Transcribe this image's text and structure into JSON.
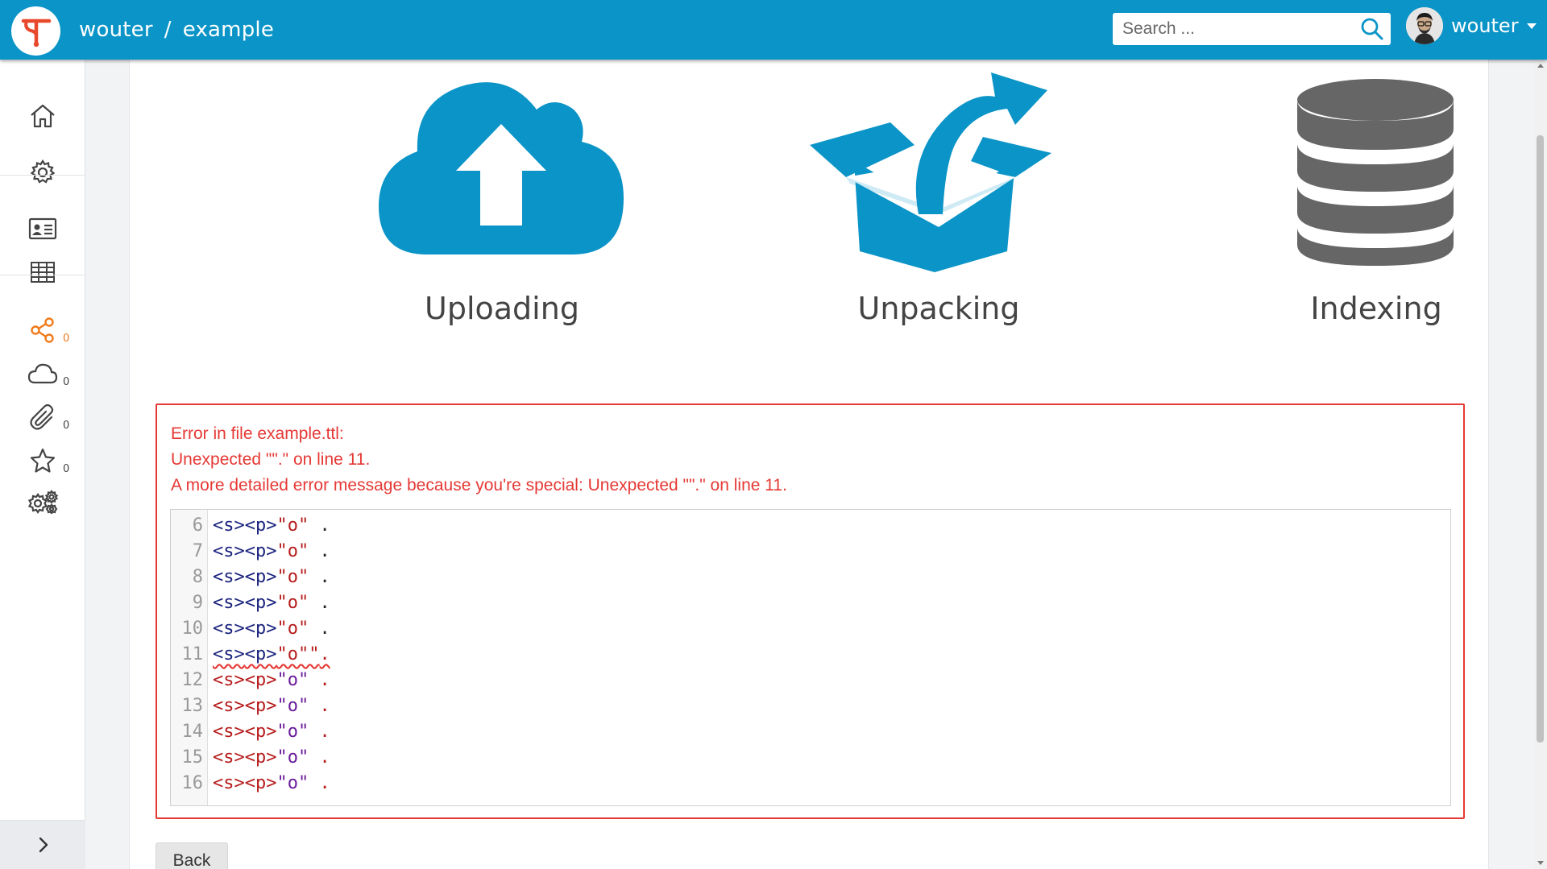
{
  "header": {
    "logo_letter": "T",
    "breadcrumb": {
      "user": "wouter",
      "separator": "/",
      "dataset": "example"
    },
    "search": {
      "placeholder": "Search ..."
    },
    "account": {
      "name": "wouter"
    }
  },
  "sidebar": {
    "items": [
      {
        "icon": "home-icon"
      },
      {
        "icon": "gear-icon"
      },
      {
        "icon": "id-card-icon"
      },
      {
        "icon": "table-icon"
      },
      {
        "icon": "share-graph-icon",
        "count": "0"
      },
      {
        "icon": "cloud-icon",
        "count": "0"
      },
      {
        "icon": "paperclip-icon",
        "count": "0"
      },
      {
        "icon": "star-icon",
        "count": "0"
      },
      {
        "icon": "gears-icon"
      },
      {
        "icon": "git-branch-icon"
      }
    ],
    "expand_icon": "chevron-right-icon"
  },
  "steps": [
    {
      "label": "Uploading",
      "icon": "cloud-upload-icon",
      "color": "#0b94c7"
    },
    {
      "label": "Unpacking",
      "icon": "box-open-icon",
      "color": "#0b94c7"
    },
    {
      "label": "Indexing",
      "icon": "database-icon",
      "color": "#666666"
    }
  ],
  "error": {
    "line1": "Error in file example.ttl:",
    "line2": "Unexpected \"\".\" on line 11.",
    "line3": "A more detailed error message because you're special: Unexpected \"\".\" on line 11.",
    "color": "#e53935",
    "code_lines": [
      {
        "num": "6",
        "s": "<s>",
        "p": "<p>",
        "o": "\"o\"",
        "end": " ."
      },
      {
        "num": "7",
        "s": "<s>",
        "p": "<p>",
        "o": "\"o\"",
        "end": " ."
      },
      {
        "num": "8",
        "s": "<s>",
        "p": "<p>",
        "o": "\"o\"",
        "end": " ."
      },
      {
        "num": "9",
        "s": "<s>",
        "p": "<p>",
        "o": "\"o\"",
        "end": " ."
      },
      {
        "num": "10",
        "s": "<s>",
        "p": "<p>",
        "o": "\"o\"",
        "end": " ."
      },
      {
        "num": "11",
        "s": "<s>",
        "p": "<p>",
        "o": "\"o\"\"",
        "end": "."
      },
      {
        "num": "12",
        "s": "<s>",
        "p": "<p>",
        "o": "\"o\"",
        "end": " ."
      },
      {
        "num": "13",
        "s": "<s>",
        "p": "<p>",
        "o": "\"o\"",
        "end": " ."
      },
      {
        "num": "14",
        "s": "<s>",
        "p": "<p>",
        "o": "\"o\"",
        "end": " ."
      },
      {
        "num": "15",
        "s": "<s>",
        "p": "<p>",
        "o": "\"o\"",
        "end": " ."
      },
      {
        "num": "16",
        "s": "<s>",
        "p": "<p>",
        "o": "\"o\"",
        "end": " ."
      }
    ]
  },
  "back_button": {
    "label": "Back"
  }
}
